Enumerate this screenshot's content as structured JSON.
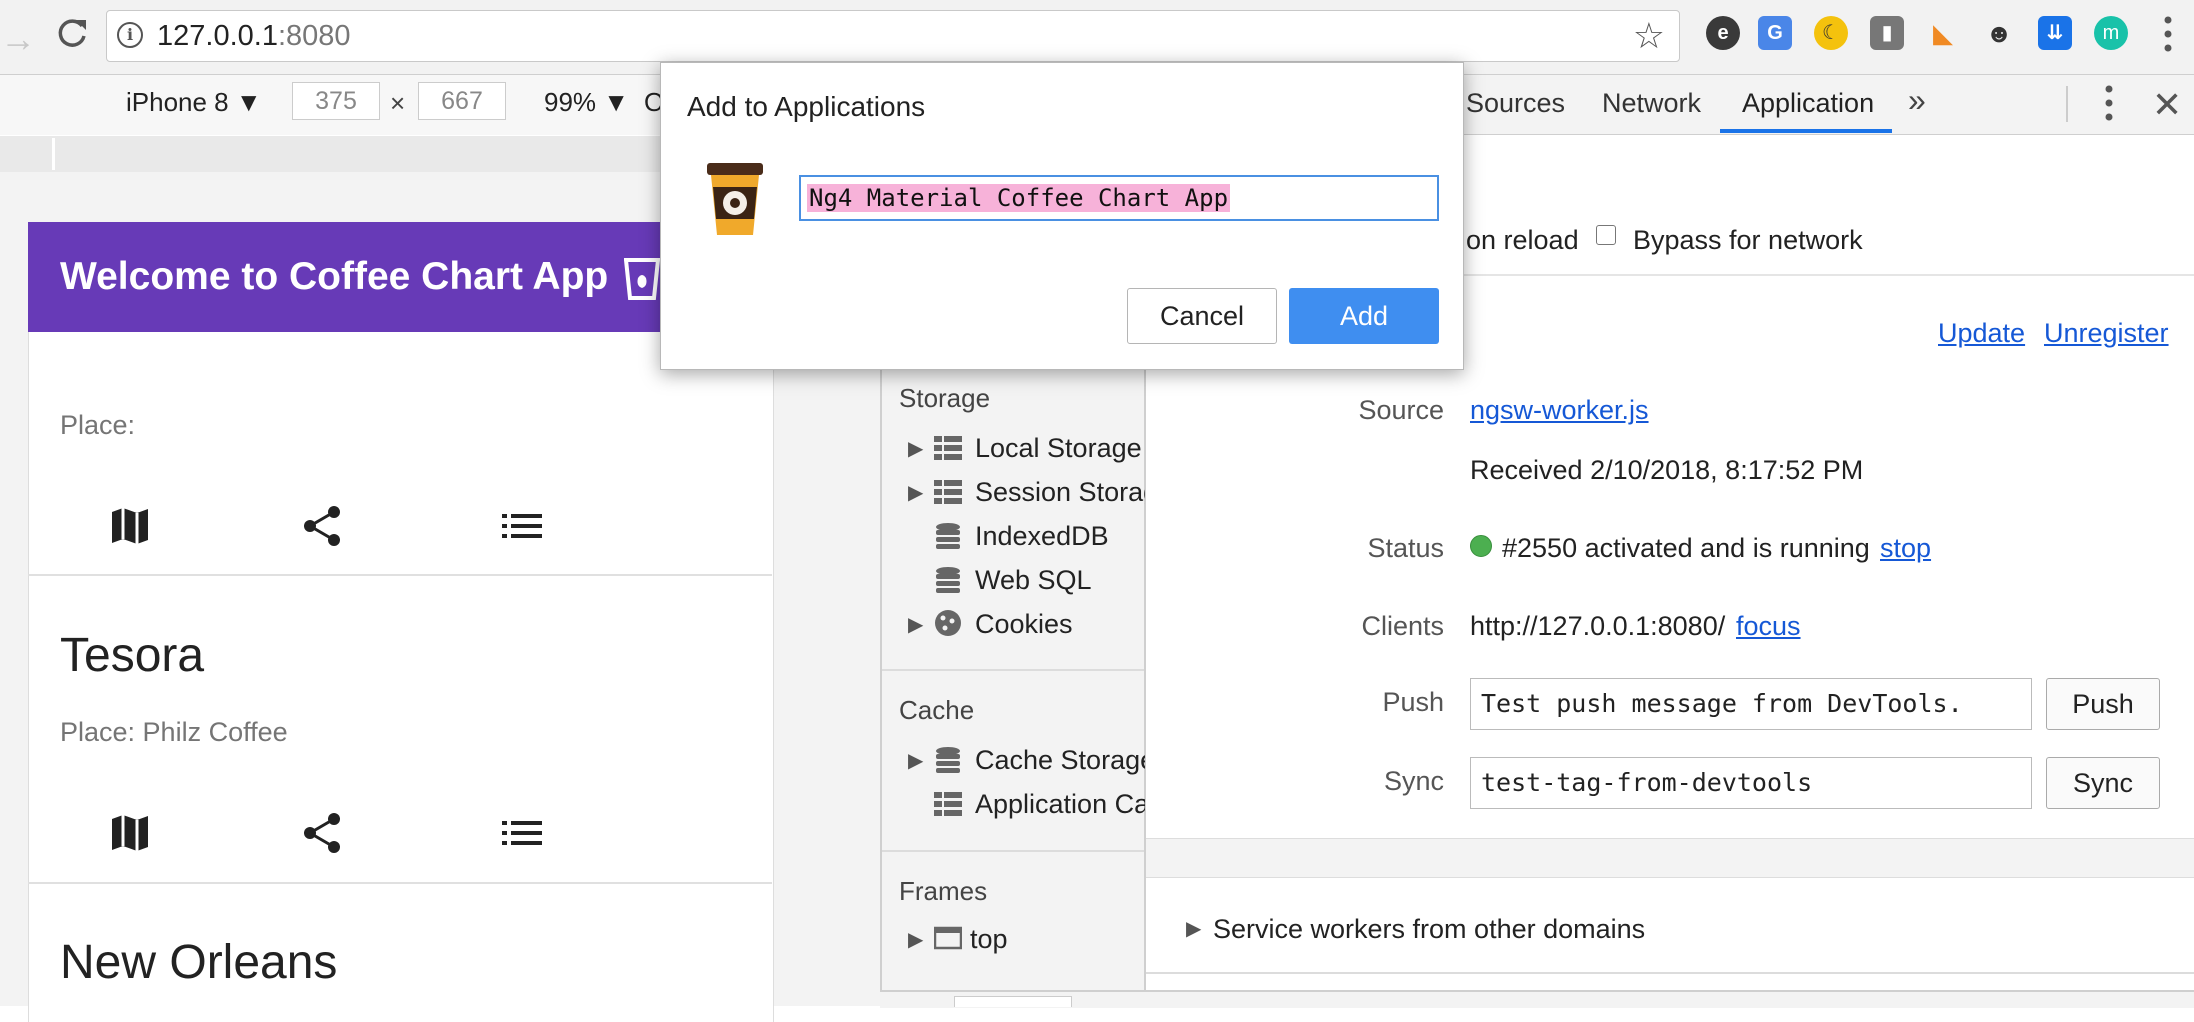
{
  "browser": {
    "url_host": "127.0.0.1",
    "url_port": ":8080",
    "extensions": [
      "evernote-icon",
      "google-translate-icon",
      "dark-moon-icon",
      "profile-icon",
      "tag-icon",
      "cat-icon",
      "pocket-icon",
      "m-avatar-icon"
    ]
  },
  "device_toolbar": {
    "device": "iPhone 8 ▼",
    "width": "375",
    "times": "×",
    "height": "667",
    "zoom": "99% ▼",
    "cut_text": "O"
  },
  "app": {
    "title": "Welcome to Coffee Chart App",
    "cards": [
      {
        "title": "",
        "place": "Place:"
      },
      {
        "title": "Tesora",
        "place": "Place: Philz Coffee"
      },
      {
        "title": "New Orleans",
        "place": ""
      }
    ]
  },
  "devtools": {
    "tabs": {
      "sources": "Sources",
      "network": "Network",
      "application": "Application",
      "more": "»"
    },
    "options": {
      "update_on_reload_partial": "on reload",
      "bypass": "Bypass for network"
    },
    "actions": {
      "update": "Update",
      "unregister": "Unregister"
    },
    "sidebar": {
      "storage_heading": "Storage",
      "storage_items": [
        "Local Storage",
        "Session Storag",
        "IndexedDB",
        "Web SQL",
        "Cookies"
      ],
      "cache_heading": "Cache",
      "cache_items": [
        "Cache Storage",
        "Application Cac"
      ],
      "frames_heading": "Frames",
      "frames_items": [
        "top"
      ]
    },
    "service_worker": {
      "source_label": "Source",
      "source_file": "ngsw-worker.js",
      "received": "Received 2/10/2018, 8:17:52 PM",
      "status_label": "Status",
      "status_text": "#2550 activated and is running",
      "stop": "stop",
      "clients_label": "Clients",
      "clients_url": "http://127.0.0.1:8080/",
      "focus": "focus",
      "push_label": "Push",
      "push_value": "Test push message from DevTools.",
      "push_button": "Push",
      "sync_label": "Sync",
      "sync_value": "test-tag-from-devtools",
      "sync_button": "Sync",
      "status_color": "#4caf50"
    },
    "other_domains": "Service workers from other domains"
  },
  "dialog": {
    "title": "Add to Applications",
    "app_name": "Ng4 Material Coffee Chart App",
    "cancel": "Cancel",
    "add": "Add"
  },
  "colors": {
    "app_header": "#673ab7",
    "link": "#1558d6",
    "add_button": "#3f8ef0",
    "selection": "#f7b2d9"
  }
}
